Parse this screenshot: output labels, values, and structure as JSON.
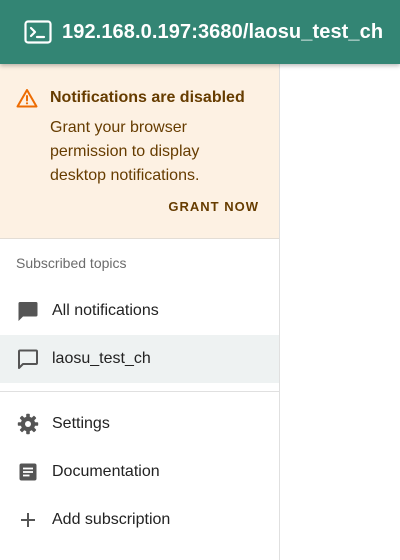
{
  "header": {
    "title": "192.168.0.197:3680/laosu_test_ch",
    "icon": "terminal-icon",
    "background": "#338574"
  },
  "notification_alert": {
    "icon": "warning-icon",
    "title": "Notifications are disabled",
    "body": "Grant your browser permission to display desktop notifications.",
    "action_label": "GRANT NOW",
    "background": "#fdf1e3",
    "warning_color": "#ed6c02"
  },
  "sidebar": {
    "section_label": "Subscribed topics",
    "topics": [
      {
        "label": "All notifications",
        "icon": "chat-filled-icon",
        "selected": false
      },
      {
        "label": "laosu_test_ch",
        "icon": "chat-outline-icon",
        "selected": true
      }
    ],
    "links": [
      {
        "label": "Settings",
        "icon": "gear-icon"
      },
      {
        "label": "Documentation",
        "icon": "article-icon"
      },
      {
        "label": "Add subscription",
        "icon": "plus-icon"
      }
    ]
  }
}
